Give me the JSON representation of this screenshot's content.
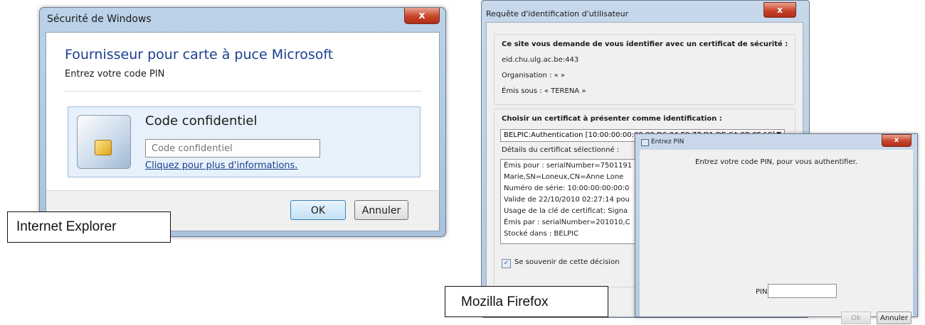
{
  "ie": {
    "window_title": "Sécurité de Windows",
    "close": "x",
    "heading": "Fournisseur pour carte à puce Microsoft",
    "subheading": "Entrez votre code PIN",
    "credential_title": "Code confidentiel",
    "pin_placeholder": "Code confidentiel",
    "more_info_link": "Cliquez pour plus d'informations.",
    "ok": "OK",
    "cancel": "Annuler",
    "caption": "Internet Explorer"
  },
  "firefox": {
    "window_title": "Requête d'identification d'utilisateur",
    "close": "x",
    "site_prompt": "Ce site vous demande de vous identifier avec un certificat de sécurité :",
    "host": "eid.chu.ulg.ac.be:443",
    "organisation": "Organisation : « »",
    "issued_under": "Émis sous : « TERENA »",
    "choose_prompt": "Choisir un certificat à présenter comme identification :",
    "selected_cert": "BELPIC:Authentication [10:00:00:00:00:00:D6:04:E9:77:D1:DE:CA:9B:0F:6C]",
    "details_label": "Détails du certificat sélectionné :",
    "details": [
      "Émis pour : serialNumber=7501191",
      "Marie,SN=Loneux,CN=Anne Lone",
      "  Numéro de série: 10:00:00:00:00:0",
      "  Valide de 22/10/2010 02:27:14 pou",
      "  Usage de la clé de certificat: Signa",
      "Émis par : serialNumber=201010,C",
      "Stocké dans : BELPIC"
    ],
    "remember": "Se souvenir de cette décision",
    "caption": "Mozilla Firefox"
  },
  "pin": {
    "window_title": "Entrez PIN",
    "close": "x",
    "message": "Entrez votre code PIN, pour vous authentifier.",
    "pin_label": "PIN",
    "ok": "Ok",
    "cancel": "Annuler"
  }
}
